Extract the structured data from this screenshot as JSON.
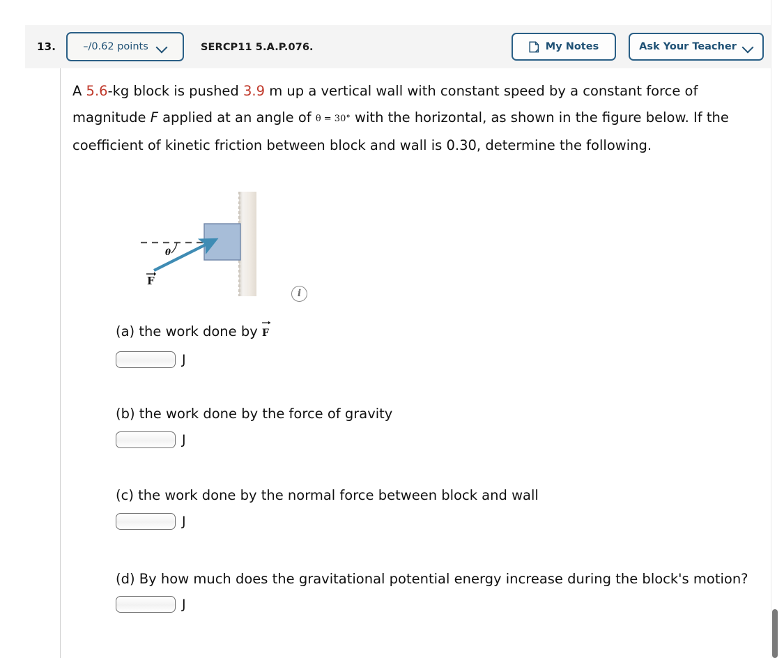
{
  "header": {
    "question_number": "13.",
    "points_label": "–/0.62 points",
    "points_chevron_icon": "chevron-down-icon",
    "question_code": "SERCP11 5.A.P.076.",
    "my_notes_label": "My Notes",
    "my_notes_icon": "note-page-icon",
    "ask_teacher_label": "Ask Your Teacher",
    "ask_teacher_chevron_icon": "chevron-down-icon",
    "accent_color": "#2a5f86",
    "background_color": "#f4f4f4"
  },
  "question": {
    "text_part1": "A ",
    "mass": "5.6",
    "text_part2": "-kg block is pushed ",
    "distance": "3.9",
    "text_part3": " m up a vertical wall with constant speed by a constant force of magnitude ",
    "force_symbol": "F",
    "text_part4": " applied at an angle of ",
    "angle_math": "θ = 30°",
    "text_part5": " with the horizontal, as shown in the figure below. If the coefficient of kinetic friction between block and wall is 0.30, determine the following.",
    "highlight_color": "#c0392b"
  },
  "figure": {
    "theta_label": "θ",
    "force_label": "F",
    "info_icon": "info-circle-icon",
    "info_glyph": "i",
    "block_fill": "#a7bdd8",
    "block_stroke": "#6f86a8",
    "arrow_color": "#3f8cb4",
    "wall_color": "#e8e2da",
    "dashed_line_color": "#555555"
  },
  "parts": [
    {
      "label": "(a) the work done by ",
      "has_vector_F": true,
      "vector_symbol": "F",
      "value": "",
      "unit": "J"
    },
    {
      "label": "(b) the work done by the force of gravity",
      "has_vector_F": false,
      "value": "",
      "unit": "J"
    },
    {
      "label": "(c) the work done by the normal force between block and wall",
      "has_vector_F": false,
      "value": "",
      "unit": "J"
    },
    {
      "label": "(d) By how much does the gravitational potential energy increase during the block's motion?",
      "has_vector_F": false,
      "value": "",
      "unit": "J"
    }
  ],
  "scrollbar": {
    "thumb_color": "#7a7a7a"
  }
}
